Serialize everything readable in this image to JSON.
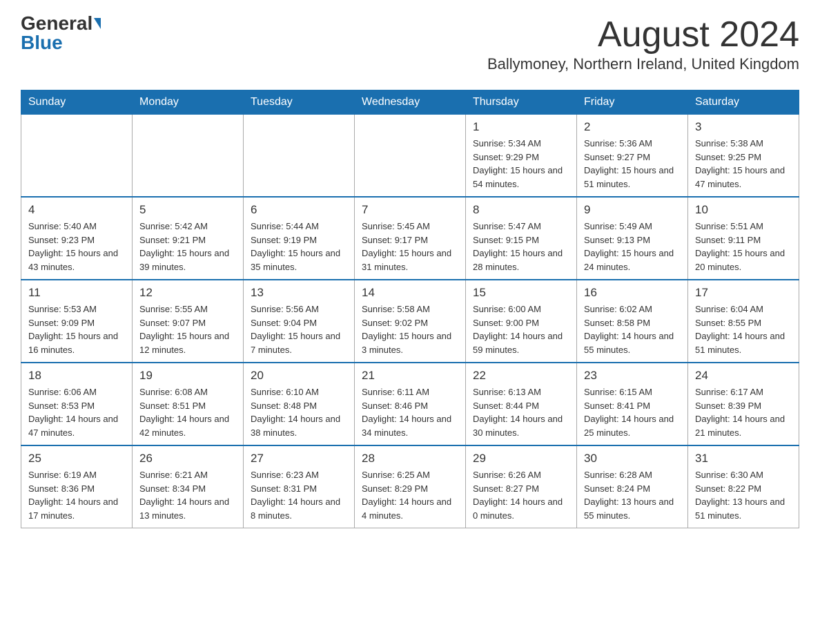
{
  "header": {
    "logo_general": "General",
    "logo_blue": "Blue",
    "month_title": "August 2024",
    "location": "Ballymoney, Northern Ireland, United Kingdom"
  },
  "weekdays": [
    "Sunday",
    "Monday",
    "Tuesday",
    "Wednesday",
    "Thursday",
    "Friday",
    "Saturday"
  ],
  "weeks": [
    [
      {
        "day": "",
        "info": ""
      },
      {
        "day": "",
        "info": ""
      },
      {
        "day": "",
        "info": ""
      },
      {
        "day": "",
        "info": ""
      },
      {
        "day": "1",
        "info": "Sunrise: 5:34 AM\nSunset: 9:29 PM\nDaylight: 15 hours and 54 minutes."
      },
      {
        "day": "2",
        "info": "Sunrise: 5:36 AM\nSunset: 9:27 PM\nDaylight: 15 hours and 51 minutes."
      },
      {
        "day": "3",
        "info": "Sunrise: 5:38 AM\nSunset: 9:25 PM\nDaylight: 15 hours and 47 minutes."
      }
    ],
    [
      {
        "day": "4",
        "info": "Sunrise: 5:40 AM\nSunset: 9:23 PM\nDaylight: 15 hours and 43 minutes."
      },
      {
        "day": "5",
        "info": "Sunrise: 5:42 AM\nSunset: 9:21 PM\nDaylight: 15 hours and 39 minutes."
      },
      {
        "day": "6",
        "info": "Sunrise: 5:44 AM\nSunset: 9:19 PM\nDaylight: 15 hours and 35 minutes."
      },
      {
        "day": "7",
        "info": "Sunrise: 5:45 AM\nSunset: 9:17 PM\nDaylight: 15 hours and 31 minutes."
      },
      {
        "day": "8",
        "info": "Sunrise: 5:47 AM\nSunset: 9:15 PM\nDaylight: 15 hours and 28 minutes."
      },
      {
        "day": "9",
        "info": "Sunrise: 5:49 AM\nSunset: 9:13 PM\nDaylight: 15 hours and 24 minutes."
      },
      {
        "day": "10",
        "info": "Sunrise: 5:51 AM\nSunset: 9:11 PM\nDaylight: 15 hours and 20 minutes."
      }
    ],
    [
      {
        "day": "11",
        "info": "Sunrise: 5:53 AM\nSunset: 9:09 PM\nDaylight: 15 hours and 16 minutes."
      },
      {
        "day": "12",
        "info": "Sunrise: 5:55 AM\nSunset: 9:07 PM\nDaylight: 15 hours and 12 minutes."
      },
      {
        "day": "13",
        "info": "Sunrise: 5:56 AM\nSunset: 9:04 PM\nDaylight: 15 hours and 7 minutes."
      },
      {
        "day": "14",
        "info": "Sunrise: 5:58 AM\nSunset: 9:02 PM\nDaylight: 15 hours and 3 minutes."
      },
      {
        "day": "15",
        "info": "Sunrise: 6:00 AM\nSunset: 9:00 PM\nDaylight: 14 hours and 59 minutes."
      },
      {
        "day": "16",
        "info": "Sunrise: 6:02 AM\nSunset: 8:58 PM\nDaylight: 14 hours and 55 minutes."
      },
      {
        "day": "17",
        "info": "Sunrise: 6:04 AM\nSunset: 8:55 PM\nDaylight: 14 hours and 51 minutes."
      }
    ],
    [
      {
        "day": "18",
        "info": "Sunrise: 6:06 AM\nSunset: 8:53 PM\nDaylight: 14 hours and 47 minutes."
      },
      {
        "day": "19",
        "info": "Sunrise: 6:08 AM\nSunset: 8:51 PM\nDaylight: 14 hours and 42 minutes."
      },
      {
        "day": "20",
        "info": "Sunrise: 6:10 AM\nSunset: 8:48 PM\nDaylight: 14 hours and 38 minutes."
      },
      {
        "day": "21",
        "info": "Sunrise: 6:11 AM\nSunset: 8:46 PM\nDaylight: 14 hours and 34 minutes."
      },
      {
        "day": "22",
        "info": "Sunrise: 6:13 AM\nSunset: 8:44 PM\nDaylight: 14 hours and 30 minutes."
      },
      {
        "day": "23",
        "info": "Sunrise: 6:15 AM\nSunset: 8:41 PM\nDaylight: 14 hours and 25 minutes."
      },
      {
        "day": "24",
        "info": "Sunrise: 6:17 AM\nSunset: 8:39 PM\nDaylight: 14 hours and 21 minutes."
      }
    ],
    [
      {
        "day": "25",
        "info": "Sunrise: 6:19 AM\nSunset: 8:36 PM\nDaylight: 14 hours and 17 minutes."
      },
      {
        "day": "26",
        "info": "Sunrise: 6:21 AM\nSunset: 8:34 PM\nDaylight: 14 hours and 13 minutes."
      },
      {
        "day": "27",
        "info": "Sunrise: 6:23 AM\nSunset: 8:31 PM\nDaylight: 14 hours and 8 minutes."
      },
      {
        "day": "28",
        "info": "Sunrise: 6:25 AM\nSunset: 8:29 PM\nDaylight: 14 hours and 4 minutes."
      },
      {
        "day": "29",
        "info": "Sunrise: 6:26 AM\nSunset: 8:27 PM\nDaylight: 14 hours and 0 minutes."
      },
      {
        "day": "30",
        "info": "Sunrise: 6:28 AM\nSunset: 8:24 PM\nDaylight: 13 hours and 55 minutes."
      },
      {
        "day": "31",
        "info": "Sunrise: 6:30 AM\nSunset: 8:22 PM\nDaylight: 13 hours and 51 minutes."
      }
    ]
  ]
}
